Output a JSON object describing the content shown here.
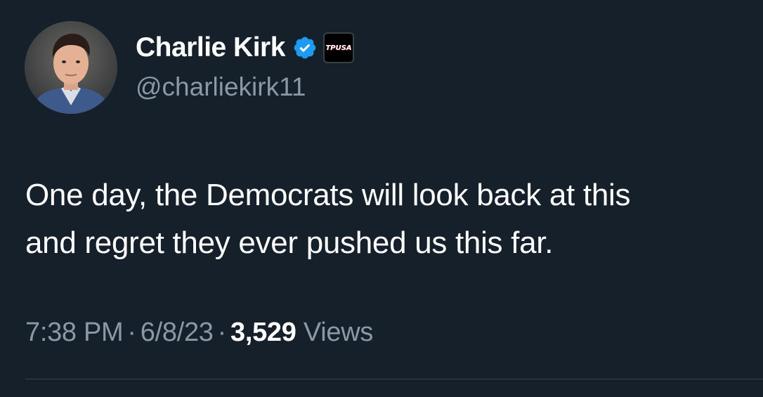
{
  "author": {
    "display_name": "Charlie Kirk",
    "handle": "@charliekirk11",
    "verified_icon": "verified-badge-icon",
    "affiliate_badge_text": "TPUSA"
  },
  "tweet": {
    "text_lines": [
      "One day, the Democrats will look back at this",
      "and regret they ever pushed us this far."
    ],
    "time": "7:38 PM",
    "separator": "·",
    "date": "6/8/23",
    "views_count": "3,529",
    "views_label": "Views"
  },
  "colors": {
    "background": "#15202b",
    "primary_text": "#ffffff",
    "secondary_text": "#8b98a5",
    "verified_blue": "#1d9bf0",
    "divider": "#38444d"
  }
}
